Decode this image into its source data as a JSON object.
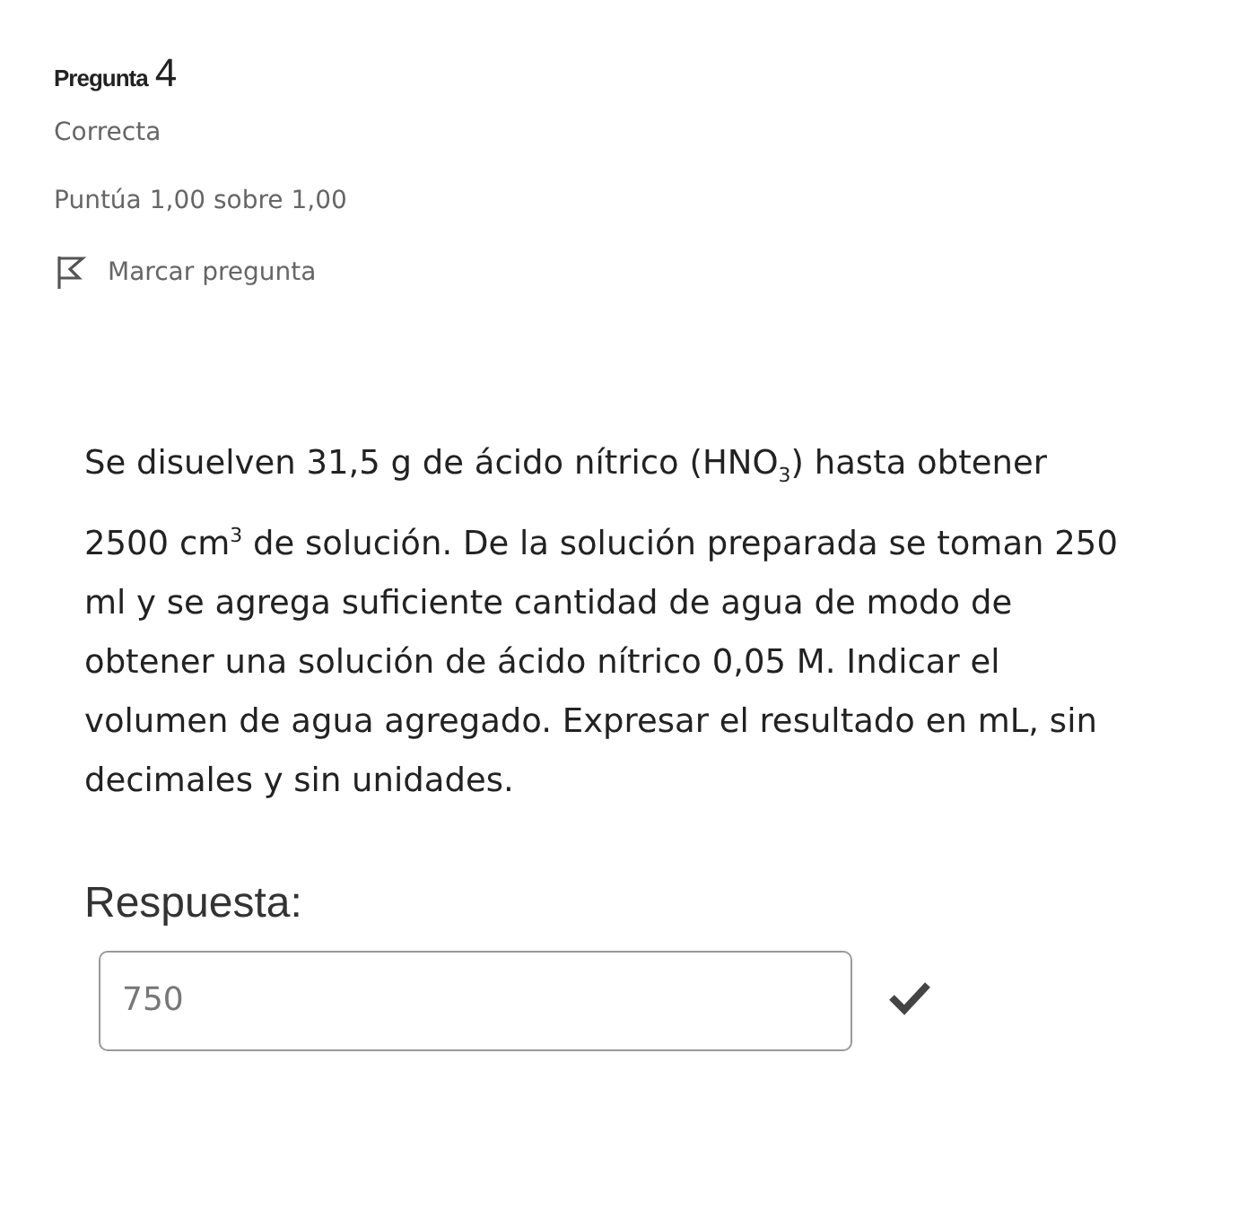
{
  "question_info": {
    "label": "Pregunta",
    "number": "4",
    "state": "Correcta",
    "grade": "Puntúa 1,00 sobre 1,00",
    "flag_label": "Marcar pregunta"
  },
  "question": {
    "text": "Se disuelven 31,5 g de ácido nítrico (HNO$_{3}$) hasta obtener 2500 cm$^{3}$ de solución. De la solución preparada se toman 250 ml y se agrega suficiente cantidad de agua de modo de obtener una solución de ácido nítrico 0,05 M. Indicar el volumen de agua agregado. Expresar el resultado en mL, sin decimales y sin unidades."
  },
  "answer": {
    "label": "Respuesta:",
    "value": "750",
    "correct": true
  }
}
